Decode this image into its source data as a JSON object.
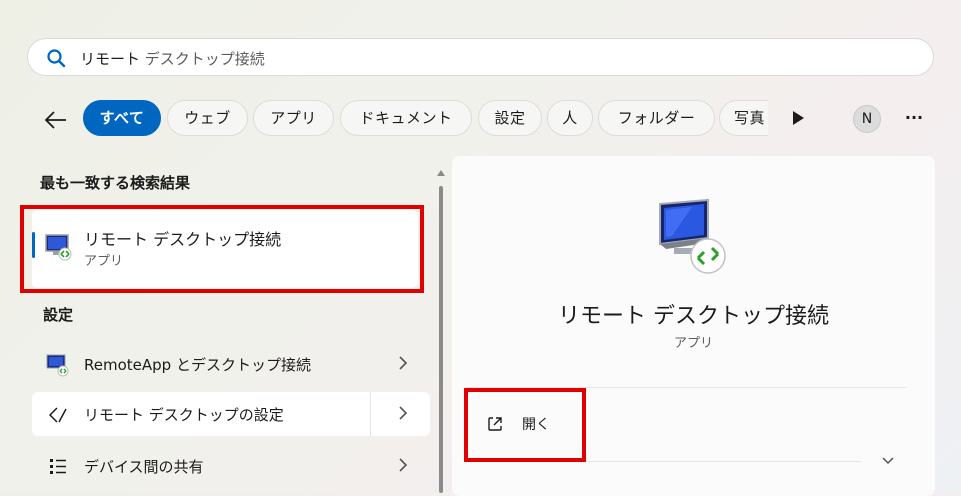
{
  "search": {
    "value_typed": "リモート",
    "value_completion": " デスクトップ接続"
  },
  "filters": [
    "すべて",
    "ウェブ",
    "アプリ",
    "ドキュメント",
    "設定",
    "人",
    "フォルダー",
    "写真"
  ],
  "avatar_initial": "N",
  "overflow_label": "···",
  "left": {
    "best_match_heading": "最も一致する検索結果",
    "best_match": {
      "title": "リモート デスクトップ接続",
      "subtitle": "アプリ"
    },
    "settings_heading": "設定",
    "settings_items": [
      {
        "label": "RemoteApp とデスクトップ接続",
        "icon": "remoteapp-icon"
      },
      {
        "label": "リモート デスクトップの設定",
        "icon": "remote-desktop-settings-icon"
      },
      {
        "label": "デバイス間の共有",
        "icon": "list-share-icon"
      }
    ]
  },
  "detail": {
    "title": "リモート デスクトップ接続",
    "subtitle": "アプリ",
    "actions": [
      {
        "label": "開く",
        "icon": "open-external-icon"
      }
    ]
  },
  "colors": {
    "accent": "#0067c0",
    "highlight_box": "#e00000"
  }
}
